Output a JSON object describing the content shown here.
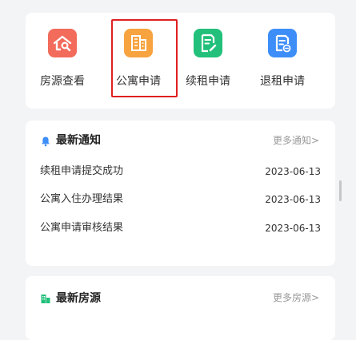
{
  "quick_actions": [
    {
      "label": "房源查看",
      "icon": "house-search-icon",
      "color": "#f26b5b"
    },
    {
      "label": "公寓申请",
      "icon": "apartment-building-icon",
      "color": "#f7a33f"
    },
    {
      "label": "续租申请",
      "icon": "document-edit-icon",
      "color": "#22c07a"
    },
    {
      "label": "退租申请",
      "icon": "document-cancel-icon",
      "color": "#3d8ef8"
    }
  ],
  "notices": {
    "title": "最新通知",
    "more_label": "更多通知>",
    "icon": "bell-icon",
    "items": [
      {
        "title": "续租申请提交成功",
        "date": "2023-06-13"
      },
      {
        "title": "公寓入住办理结果",
        "date": "2023-06-13"
      },
      {
        "title": "公寓申请审核结果",
        "date": "2023-06-13"
      }
    ]
  },
  "houses": {
    "title": "最新房源",
    "more_label": "更多房源>",
    "icon": "building-icon"
  },
  "colors": {
    "highlight": "#e02020",
    "bell": "#3d8ef8",
    "building": "#22c07a"
  }
}
